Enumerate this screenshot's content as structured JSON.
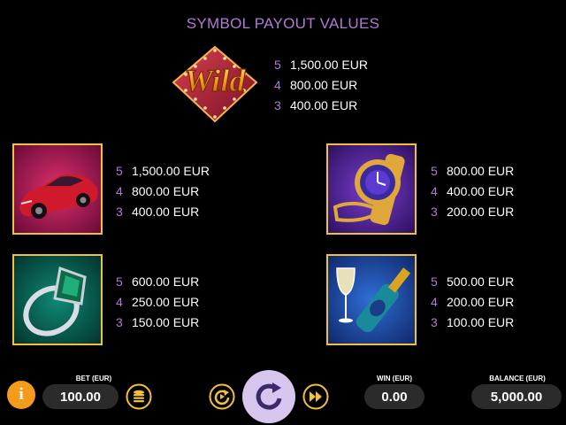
{
  "title": "SYMBOL PAYOUT VALUES",
  "wild": {
    "logo_text": "Wild",
    "payouts": [
      {
        "count": "5",
        "amount": "1,500.00 EUR"
      },
      {
        "count": "4",
        "amount": "800.00 EUR"
      },
      {
        "count": "3",
        "amount": "400.00 EUR"
      }
    ]
  },
  "symbols": [
    {
      "name": "car",
      "payouts": [
        {
          "count": "5",
          "amount": "1,500.00 EUR"
        },
        {
          "count": "4",
          "amount": "800.00 EUR"
        },
        {
          "count": "3",
          "amount": "400.00 EUR"
        }
      ]
    },
    {
      "name": "watch",
      "payouts": [
        {
          "count": "5",
          "amount": "800.00 EUR"
        },
        {
          "count": "4",
          "amount": "400.00 EUR"
        },
        {
          "count": "3",
          "amount": "200.00 EUR"
        }
      ]
    },
    {
      "name": "ring",
      "payouts": [
        {
          "count": "5",
          "amount": "600.00 EUR"
        },
        {
          "count": "4",
          "amount": "250.00 EUR"
        },
        {
          "count": "3",
          "amount": "150.00 EUR"
        }
      ]
    },
    {
      "name": "champagne",
      "payouts": [
        {
          "count": "5",
          "amount": "500.00 EUR"
        },
        {
          "count": "4",
          "amount": "200.00 EUR"
        },
        {
          "count": "3",
          "amount": "100.00 EUR"
        }
      ]
    }
  ],
  "controls": {
    "info_label": "i",
    "bet_label": "BET (EUR)",
    "bet_value": "100.00",
    "win_label": "WIN (EUR)",
    "win_value": "0.00",
    "balance_label": "BALANCE (EUR)",
    "balance_value": "5,000.00"
  },
  "colors": {
    "accent": "#b07ad6",
    "tile_border": "#f2c13c",
    "info_button": "#f39c1b",
    "spin_button": "#d9c6ef",
    "control_icon": "#f2c13c"
  }
}
